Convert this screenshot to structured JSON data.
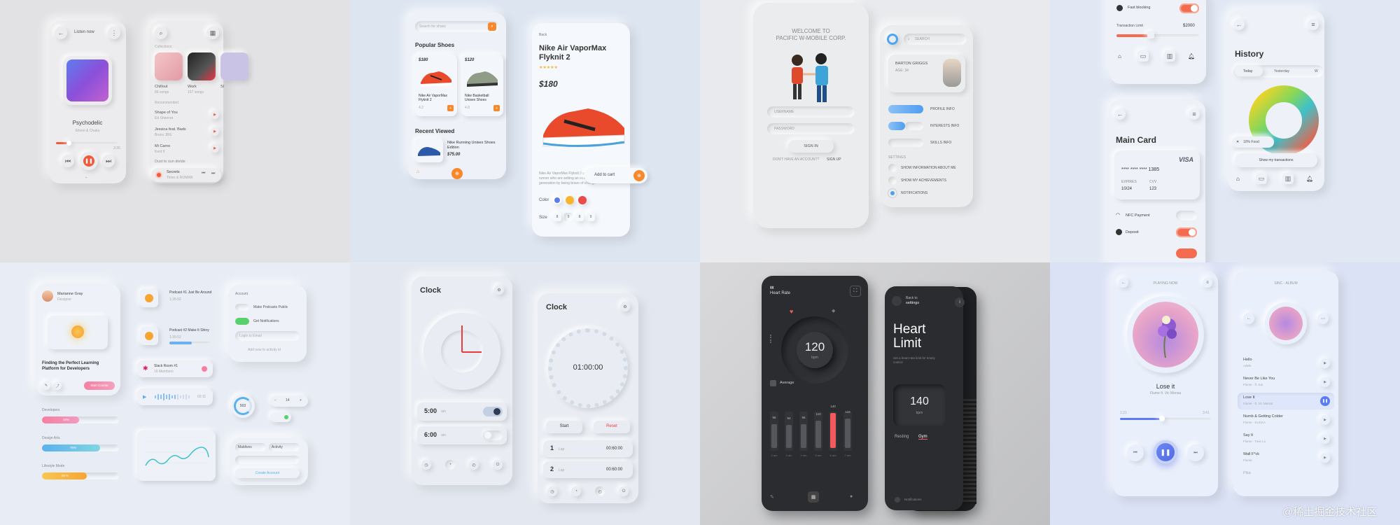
{
  "music": {
    "header": "Listen now",
    "track_title": "Psychodelic",
    "track_artist": "Eileen & Chaka",
    "time_end": "3:35",
    "collections_label": "Collections",
    "collections": [
      {
        "name": "Chillout",
        "count": "86 songs"
      },
      {
        "name": "Work",
        "count": "157 songs"
      },
      {
        "name": "Sl",
        "count": ""
      }
    ],
    "recommended_label": "Recommended",
    "tracks": [
      {
        "title": "Shape of You",
        "artist": "Ed Sheeran"
      },
      {
        "title": "Jessica feat. Bads",
        "artist": "Bruno JBG"
      },
      {
        "title": "Mi Camo",
        "artist": "Kent II"
      },
      {
        "title": "Dust to sun divide",
        "artist": ""
      }
    ],
    "now_playing": {
      "title": "Secrets",
      "artist": "Timer & ROMAN"
    }
  },
  "shoes": {
    "search_placeholder": "Search for shoes",
    "popular_title": "Popular Shoes",
    "products": [
      {
        "price": "$180",
        "name": "Nike Air VaporMax Flyknit 2",
        "rating": "4.2"
      },
      {
        "price": "$120",
        "name": "Nike Basketball Unisex Shoes",
        "rating": "4.8"
      }
    ],
    "recent_title": "Recent Viewed",
    "recent": {
      "name": "Nike Running Unisex Shoes Edition",
      "price": "$75.00"
    },
    "detail": {
      "back": "Back",
      "title": "Nike Air VaporMax Flyknit 2",
      "price": "$180",
      "desc": "Nike Air VaporMax Flyknit 2 pairs heritage to the runner who are setting an example for the next generation by being brave of change",
      "color_label": "Color",
      "size_label": "Size",
      "sizes": [
        "8",
        "9",
        "8",
        "9"
      ],
      "add_to_cart": "Add to cart"
    }
  },
  "mobile": {
    "welcome_line1": "WELCOME TO",
    "welcome_line2": "PACIFIC W-MOBILE CORP.",
    "username_placeholder": "USERNAME",
    "password_placeholder": "PASSWORD",
    "signin": "SIGN IN",
    "no_account": "DON'T HAVE AN ACCOUNT?",
    "signup": "SIGN UP",
    "search_placeholder": "SEARCH",
    "profile_name": "BARTON GRIGGS",
    "profile_age": "AGE: 34",
    "menu": [
      "PROFILE INFO",
      "INTERESTS INFO",
      "SKILLS INFO"
    ],
    "settings_label": "SETTINGS",
    "settings": [
      "SHOW INFORMATION ABOUT ME",
      "SHOW MY ACHIEVEMENTS",
      "NOTIFICATIONS"
    ]
  },
  "finance": {
    "fast_blocking": "Fast blocking",
    "transaction_limit_label": "Transaction Limit",
    "transaction_limit_value": "$2000",
    "main_card_title": "Main Card",
    "card_brand": "VISA",
    "card_masked": "****   ****   ****   1385",
    "expires_label": "EXPIRES",
    "expires_value": "10/24",
    "cvv_label": "CVV",
    "cvv_value": "123",
    "options": [
      "NFC Payment",
      "Deposit"
    ],
    "history_title": "History",
    "history_tabs": [
      "Today",
      "Yesterday",
      "W"
    ],
    "history_item": "10% Food",
    "show_transactions": "Show my transactions"
  },
  "dashboard": {
    "user_name": "Marianne Gray",
    "user_role": "Designer",
    "course_title": "Finding the Perfect Learning Platform for Developers",
    "course_button": "Start Course",
    "podcasts": [
      {
        "title": "Podcast #1 Just Be Around",
        "time": "1:35:52"
      },
      {
        "title": "Podcast #2 Make It Shiny",
        "time": "1:35:52"
      }
    ],
    "slack_title": "Slack Room #1",
    "slack_sub": "16 Members",
    "audio_time": "02:11",
    "progress_value": "503",
    "settings_title": "Account",
    "toggles": [
      "Make Podcasts Public",
      "Get Notifications"
    ],
    "login_placeholder": "Login to Email",
    "note": "Add new to activity id",
    "bar_labels": [
      "Developers",
      "Design Arts",
      "Lifestyle Mode"
    ],
    "bar_values": [
      "48%",
      "75%",
      "58 %"
    ],
    "stepper_value": "14",
    "select_values": [
      "Maldives",
      "Activity"
    ],
    "button_label": "Create Account"
  },
  "clock": {
    "title": "Clock",
    "alarm1_time": "5:00",
    "alarm1_suffix": "am",
    "alarm2_time": "6:00",
    "alarm2_suffix": "am",
    "timer_title": "Clock",
    "timer_value": "01:00:00",
    "start_label": "Start",
    "reset_label": "Reset",
    "laps": [
      {
        "num": "1",
        "label": "Lap",
        "time": "00:60:00"
      },
      {
        "num": "2",
        "label": "Lap",
        "time": "00:60:00"
      }
    ]
  },
  "heart": {
    "header": "Heart Rate",
    "rate_value": "120",
    "rate_unit": "bpm",
    "average_label": "Average",
    "bars": [
      {
        "label": "96",
        "value": 96,
        "day": "2 am"
      },
      {
        "label": "94",
        "value": 94,
        "day": "3 am"
      },
      {
        "label": "96",
        "value": 96,
        "day": "4 am"
      },
      {
        "label": "110",
        "value": 110,
        "day": "5 am"
      },
      {
        "label": "140",
        "value": 140,
        "day": "6 am"
      },
      {
        "label": "118",
        "value": 118,
        "day": "7 am"
      }
    ],
    "back_label": "Back to",
    "back_target": "settings",
    "limit_title_line1": "Heart",
    "limit_title_line2": "Limit",
    "limit_sub": "Set a heart rate limit for timely control",
    "limit_value": "140",
    "limit_unit": "bpm",
    "tabs": [
      "Resting",
      "Gym"
    ],
    "notifications": "Notifications",
    "accent": "#f25a5d"
  },
  "player": {
    "header": "PLAYING NOW",
    "song_title": "Lose it",
    "song_artist": "Flume ft. Vic Mensa",
    "time_start": "1:21",
    "time_end": "3:41",
    "list_header": "SINC - ALBUM",
    "songs": [
      {
        "title": "Hello",
        "artist": "Adele"
      },
      {
        "title": "Never Be Like You",
        "artist": "Flume - ft. Kai"
      },
      {
        "title": "Lose It",
        "artist": "Flume - ft. Vic Mensa"
      },
      {
        "title": "Numb & Getting Colder",
        "artist": "Flume - KUCKA"
      },
      {
        "title": "Say It",
        "artist": "Flume - Tove Lo"
      },
      {
        "title": "Wall F*ck",
        "artist": "Flume"
      },
      {
        "title": "Pika",
        "artist": ""
      }
    ],
    "accent": "#5b7bf0"
  },
  "watermark": "@稀土掘金技术社区"
}
